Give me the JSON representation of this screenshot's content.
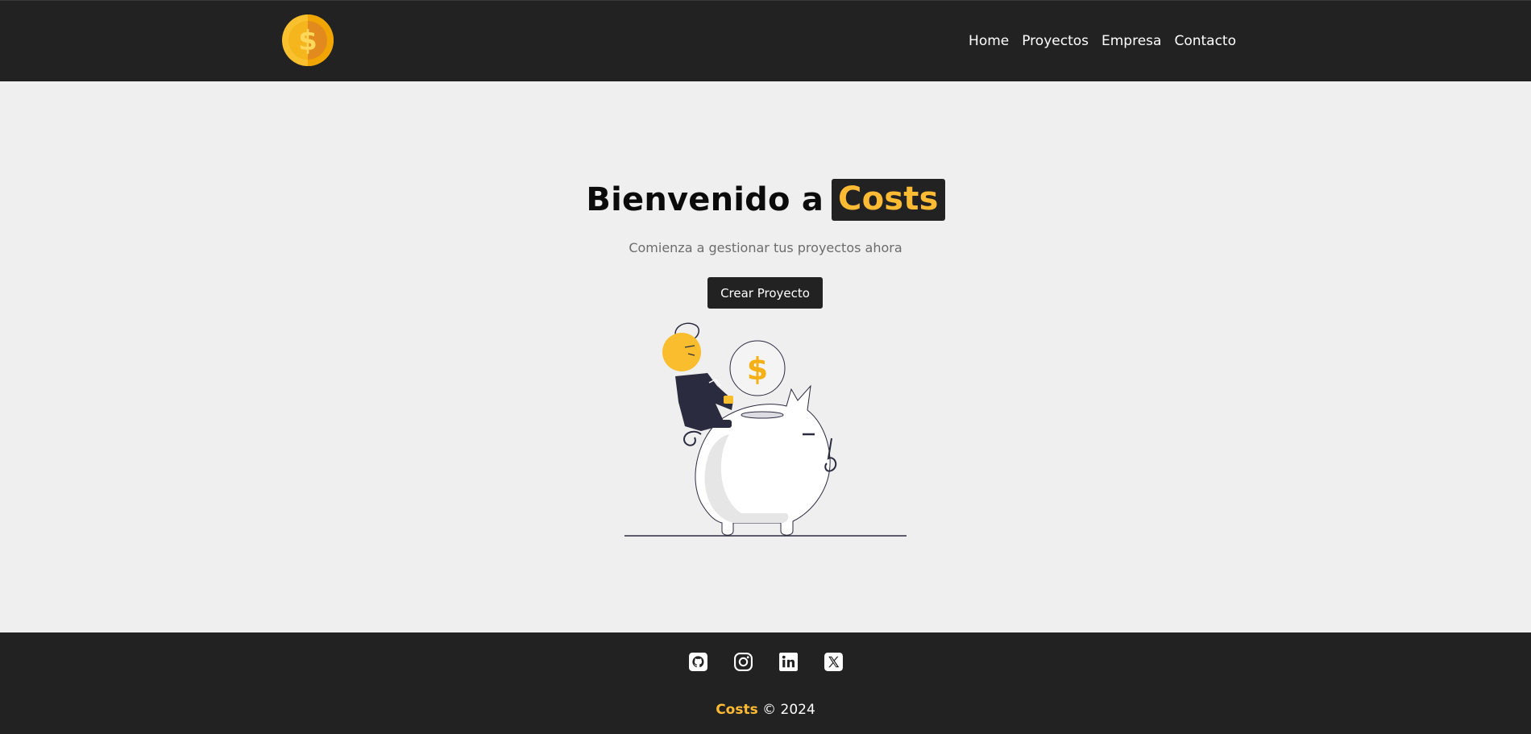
{
  "navbar": {
    "logo_icon": "dollar-coin-icon",
    "links": [
      {
        "label": "Home"
      },
      {
        "label": "Proyectos"
      },
      {
        "label": "Empresa"
      },
      {
        "label": "Contacto"
      }
    ]
  },
  "hero": {
    "title_prefix": "Bienvenido a",
    "title_brand": "Costs",
    "subtitle": "Comienza a gestionar tus proyectos ahora",
    "cta_label": "Crear Proyecto",
    "illustration": "piggy-bank-savings-illustration"
  },
  "footer": {
    "social": [
      {
        "icon": "github-icon"
      },
      {
        "icon": "instagram-icon"
      },
      {
        "icon": "linkedin-icon"
      },
      {
        "icon": "x-twitter-icon"
      }
    ],
    "brand": "Costs",
    "copyright_text": "© 2024"
  },
  "colors": {
    "background": "#efefef",
    "dark": "#222222",
    "accent": "#ffbb33",
    "text_muted": "#6c6c6c"
  }
}
